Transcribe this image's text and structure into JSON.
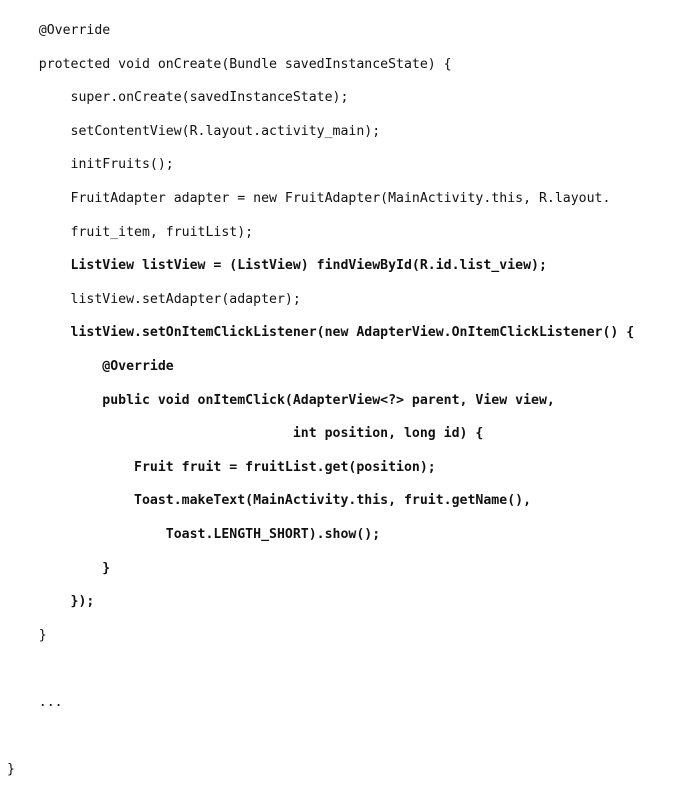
{
  "code": {
    "lines": [
      {
        "text": "    @Override",
        "bold": false
      },
      {
        "text": "    protected void onCreate(Bundle savedInstanceState) {",
        "bold": false
      },
      {
        "text": "        super.onCreate(savedInstanceState);",
        "bold": false
      },
      {
        "text": "        setContentView(R.layout.activity_main);",
        "bold": false
      },
      {
        "text": "        initFruits();",
        "bold": false
      },
      {
        "text": "        FruitAdapter adapter = new FruitAdapter(MainActivity.this, R.layout.",
        "bold": false
      },
      {
        "text": "        fruit_item, fruitList);",
        "bold": false
      },
      {
        "text": "        ListView listView = (ListView) findViewById(R.id.list_view);",
        "bold": true
      },
      {
        "text": "        listView.setAdapter(adapter);",
        "bold": false
      },
      {
        "text": "        listView.setOnItemClickListener(new AdapterView.OnItemClickListener() {",
        "bold": true
      },
      {
        "text": "            @Override",
        "bold": true
      },
      {
        "text": "            public void onItemClick(AdapterView<?> parent, View view,",
        "bold": true
      },
      {
        "text": "                                    int position, long id) {",
        "bold": true
      },
      {
        "text": "                Fruit fruit = fruitList.get(position);",
        "bold": true
      },
      {
        "text": "                Toast.makeText(MainActivity.this, fruit.getName(),",
        "bold": true
      },
      {
        "text": "                    Toast.LENGTH_SHORT).show();",
        "bold": true
      },
      {
        "text": "            }",
        "bold": true
      },
      {
        "text": "        });",
        "bold": true
      },
      {
        "text": "    }",
        "bold": false
      },
      {
        "text": "",
        "bold": false
      },
      {
        "text": "    ...",
        "bold": false
      },
      {
        "text": "",
        "bold": false
      },
      {
        "text": "}",
        "bold": false
      }
    ]
  }
}
